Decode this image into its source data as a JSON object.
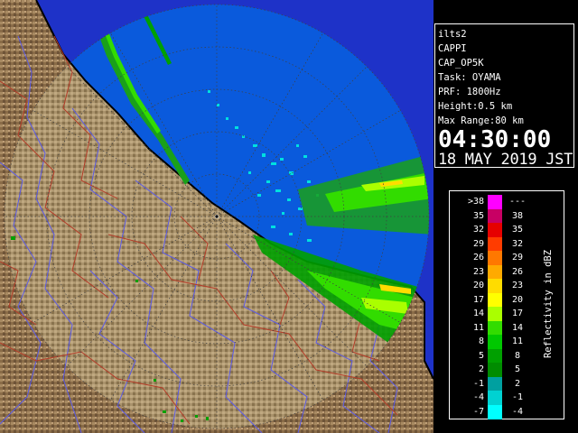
{
  "info": {
    "radar": "ilts2",
    "product": "CAPPI",
    "code": "CAP_OP5K",
    "task": "Task: OYAMA",
    "prf": "PRF: 1800Hz",
    "height": "Height:0.5 km",
    "range": "Max Range:80 km",
    "time": "04:30:00",
    "date": "18 MAY 2019 JST"
  },
  "legend": {
    "unit": "Reflectivity in dBZ",
    "rows": [
      {
        "lo": ">38",
        "hi": "---",
        "color": "#ff00ff"
      },
      {
        "lo": "35",
        "hi": "38",
        "color": "#c80064"
      },
      {
        "lo": "32",
        "hi": "35",
        "color": "#e60000"
      },
      {
        "lo": "29",
        "hi": "32",
        "color": "#ff3c00"
      },
      {
        "lo": "26",
        "hi": "29",
        "color": "#ff7800"
      },
      {
        "lo": "23",
        "hi": "26",
        "color": "#ffaa00"
      },
      {
        "lo": "20",
        "hi": "23",
        "color": "#ffdc00"
      },
      {
        "lo": "17",
        "hi": "20",
        "color": "#ffff00"
      },
      {
        "lo": "14",
        "hi": "17",
        "color": "#aaff00"
      },
      {
        "lo": "11",
        "hi": "14",
        "color": "#32dc00"
      },
      {
        "lo": "8",
        "hi": "11",
        "color": "#00c800"
      },
      {
        "lo": "5",
        "hi": "8",
        "color": "#00a000"
      },
      {
        "lo": "2",
        "hi": "5",
        "color": "#008c00"
      },
      {
        "lo": "-1",
        "hi": "2",
        "color": "#00a0a0"
      },
      {
        "lo": "-4",
        "hi": "-1",
        "color": "#00d2d2"
      },
      {
        "lo": "-7",
        "hi": "-4",
        "color": "#00ffff"
      }
    ]
  },
  "map_colors": {
    "sea_in_range": "#0a5adc",
    "sea_out_range": "#1e32c8",
    "land": "#a0825a",
    "rivers": "#5a5ae6",
    "boundaries": "#b43c28",
    "coast": "#000000",
    "range_rings": "#404040"
  },
  "radar_icon": "radar-center-marker"
}
